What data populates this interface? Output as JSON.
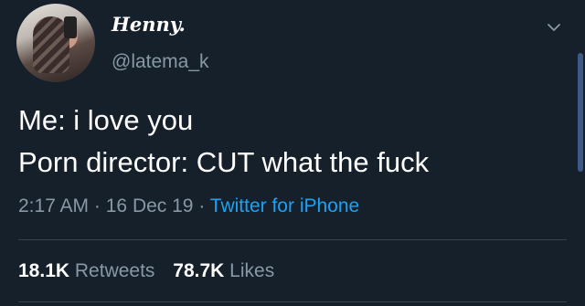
{
  "author": {
    "display_name": "Henny.",
    "handle": "@latema_k"
  },
  "tweet": {
    "lines": [
      "Me: i love you",
      "Porn director: CUT what the fuck"
    ]
  },
  "meta": {
    "time": "2:17 AM",
    "date": "16 Dec 19",
    "separator": "·",
    "source": "Twitter for iPhone"
  },
  "stats": {
    "retweets_count": "18.1K",
    "retweets_label": "Retweets",
    "likes_count": "78.7K",
    "likes_label": "Likes"
  },
  "icons": {
    "menu": "chevron-down-icon"
  },
  "colors": {
    "background": "#15202b",
    "secondary_text": "#8899a6",
    "link": "#1da1f2"
  }
}
